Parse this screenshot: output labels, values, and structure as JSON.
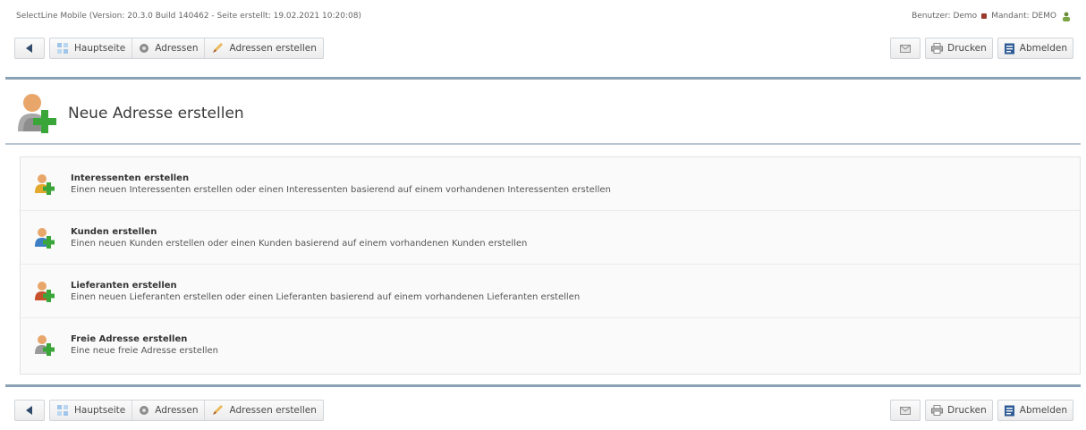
{
  "app": {
    "info": "SelectLine Mobile (Version: 20.3.0 Build 140462 - Seite erstellt: 19.02.2021 10:20:08)",
    "user_label": "Benutzer: Demo",
    "tenant_label": "Mandant: DEMO"
  },
  "toolbar": {
    "back_icon": "arrow-left-icon",
    "crumbs": [
      {
        "label": "Hauptseite",
        "icon": "home-icon"
      },
      {
        "label": "Adressen",
        "icon": "addresses-icon"
      },
      {
        "label": "Adressen erstellen",
        "icon": "pencil-icon"
      }
    ],
    "mail_icon": "mail-icon",
    "print_label": "Drucken",
    "logout_label": "Abmelden"
  },
  "page": {
    "title": "Neue Adresse erstellen",
    "icon": "add-user-icon"
  },
  "items": [
    {
      "title": "Interessenten erstellen",
      "desc": "Einen neuen Interessenten erstellen oder einen Interessenten basierend auf einem vorhandenen Interessenten erstellen",
      "color": "#e3a92c"
    },
    {
      "title": "Kunden erstellen",
      "desc": "Einen neuen Kunden erstellen oder einen Kunden basierend auf einem vorhandenen Kunden erstellen",
      "color": "#3d7fc4"
    },
    {
      "title": "Lieferanten erstellen",
      "desc": "Einen neuen Lieferanten erstellen oder einen Lieferanten basierend auf einem vorhandenen Lieferanten erstellen",
      "color": "#c8512d"
    },
    {
      "title": "Freie Adresse erstellen",
      "desc": "Eine neue freie Adresse erstellen",
      "color": "#9a9a9a"
    }
  ],
  "colors": {
    "accent_rule": "#8aa0b4",
    "plus_green": "#3aa63a"
  }
}
